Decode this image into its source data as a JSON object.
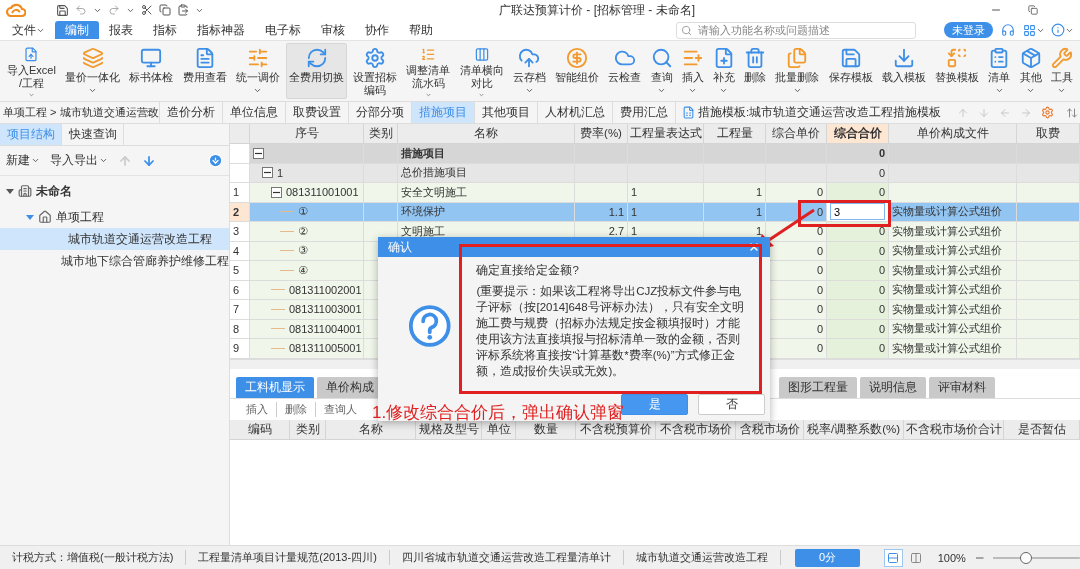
{
  "window": {
    "title": "广联达预算计价 - [招标管理 - 未命名]"
  },
  "menu": [
    {
      "label": "文件",
      "dropdown": true,
      "selected": false
    },
    {
      "label": "编制",
      "dropdown": false,
      "selected": true
    },
    {
      "label": "报表",
      "dropdown": false,
      "selected": false
    },
    {
      "label": "指标",
      "dropdown": false,
      "selected": false
    },
    {
      "label": "指标神器",
      "dropdown": false,
      "selected": false
    },
    {
      "label": "电子标",
      "dropdown": false,
      "selected": false
    },
    {
      "label": "审核",
      "dropdown": false,
      "selected": false
    },
    {
      "label": "协作",
      "dropdown": false,
      "selected": false
    },
    {
      "label": "帮助",
      "dropdown": false,
      "selected": false
    }
  ],
  "search": {
    "placeholder": "请输入功能名称或问题描述"
  },
  "login_button": "未登录",
  "ribbon": [
    {
      "lines": [
        "导入Excel",
        "/工程"
      ],
      "dropdown": true,
      "pressed": false
    },
    {
      "lines": [
        "量价一体化"
      ],
      "dropdown": true,
      "pressed": false
    },
    {
      "lines": [
        "标书体检"
      ],
      "dropdown": false,
      "pressed": false
    },
    {
      "lines": [
        "费用查看"
      ],
      "dropdown": false,
      "pressed": false
    },
    {
      "lines": [
        "统一调价"
      ],
      "dropdown": true,
      "pressed": false
    },
    {
      "lines": [
        "全费用切换"
      ],
      "dropdown": false,
      "pressed": true
    },
    {
      "lines": [
        "设置招标",
        "编码"
      ],
      "dropdown": false,
      "pressed": false
    },
    {
      "lines": [
        "调整清单",
        "流水码"
      ],
      "dropdown": true,
      "pressed": false
    },
    {
      "lines": [
        "清单横向",
        "对比"
      ],
      "dropdown": true,
      "pressed": false
    },
    {
      "lines": [
        "云存档"
      ],
      "dropdown": true,
      "pressed": false
    },
    {
      "lines": [
        "智能组价"
      ],
      "dropdown": false,
      "pressed": false
    },
    {
      "lines": [
        "云检查"
      ],
      "dropdown": false,
      "pressed": false
    },
    {
      "lines": [
        "查询"
      ],
      "dropdown": true,
      "pressed": false
    },
    {
      "lines": [
        "插入"
      ],
      "dropdown": true,
      "pressed": false
    },
    {
      "lines": [
        "补充"
      ],
      "dropdown": true,
      "pressed": false
    },
    {
      "lines": [
        "删除"
      ],
      "dropdown": false,
      "pressed": false
    },
    {
      "lines": [
        "批量删除"
      ],
      "dropdown": true,
      "pressed": false
    },
    {
      "lines": [
        "保存模板"
      ],
      "dropdown": false,
      "pressed": false
    },
    {
      "lines": [
        "载入模板"
      ],
      "dropdown": false,
      "pressed": false
    },
    {
      "lines": [
        "替换模板"
      ],
      "dropdown": false,
      "pressed": false
    },
    {
      "lines": [
        "清单"
      ],
      "dropdown": true,
      "pressed": false
    },
    {
      "lines": [
        "其他"
      ],
      "dropdown": true,
      "pressed": false
    },
    {
      "lines": [
        "工具"
      ],
      "dropdown": true,
      "pressed": false
    }
  ],
  "breadcrumb": "单项工程 > 城市轨道交通运营改",
  "view_tabs": [
    {
      "label": "造价分析",
      "selected": false
    },
    {
      "label": "单位信息",
      "selected": false
    },
    {
      "label": "取费设置",
      "selected": false
    },
    {
      "label": "分部分项",
      "selected": false
    },
    {
      "label": "措施项目",
      "selected": true
    },
    {
      "label": "其他项目",
      "selected": false
    },
    {
      "label": "人材机汇总",
      "selected": false
    },
    {
      "label": "费用汇总",
      "selected": false
    }
  ],
  "template": "措施模板:城市轨道交通运营改造工程措施模板",
  "side_tabs": [
    {
      "label": "项目结构",
      "selected": true
    },
    {
      "label": "快速查询",
      "selected": false
    }
  ],
  "side_toolbar": [
    {
      "label": "新建",
      "dropdown": true
    },
    {
      "label": "导入导出",
      "dropdown": true
    }
  ],
  "move_buttons": [
    {
      "disabled": true
    },
    {
      "disabled": false
    }
  ],
  "tree": [
    {
      "label": "未命名",
      "expanded": true,
      "selected": false,
      "children": [
        {
          "label": "单项工程",
          "expanded": true,
          "selected": false,
          "children": [
            {
              "label": "城市轨道交通运营改造工程",
              "selected": true
            },
            {
              "label": "城市地下综合管廊养护维修工程",
              "selected": false
            }
          ]
        }
      ]
    }
  ],
  "grid": {
    "columns": [
      {
        "label": "序号",
        "current": false
      },
      {
        "label": "类别",
        "current": false
      },
      {
        "label": "名称",
        "current": false
      },
      {
        "label": "费率(%)",
        "current": false
      },
      {
        "label": "工程量表达式",
        "current": false
      },
      {
        "label": "工程量",
        "current": false
      },
      {
        "label": "综合单价",
        "current": false
      },
      {
        "label": "综合合价",
        "current": true
      },
      {
        "label": "单价构成文件",
        "current": false
      },
      {
        "label": "取费",
        "current": false
      }
    ],
    "rows": [
      {
        "kind": "section",
        "expanded": true,
        "name": "措施项目",
        "total": "0",
        "selected": false,
        "editing": false,
        "children": [
          {
            "kind": "subsection",
            "code": "1",
            "expanded": true,
            "name": "总价措施项目",
            "total": "0",
            "selected": false,
            "editing": false,
            "children": [
              {
                "kind": "item",
                "row_no": "1",
                "code": "081311001001",
                "expanded": true,
                "name": "安全文明施工",
                "expr": "1",
                "qty": "1",
                "unit_price": "0",
                "total": "0",
                "selected": false,
                "editing": false,
                "children": [
                  {
                    "kind": "item",
                    "row_no": "2",
                    "code": "①",
                    "name": "环境保护",
                    "rate": "1.1",
                    "expr": "1",
                    "qty": "1",
                    "unit_price": "0",
                    "total": "3",
                    "price_file": "实物量或计算公式组价",
                    "selected": true,
                    "editing": true
                  },
                  {
                    "kind": "item",
                    "row_no": "3",
                    "code": "②",
                    "name": "文明施工",
                    "rate": "2.7",
                    "expr": "1",
                    "qty": "1",
                    "unit_price": "0",
                    "total": "0",
                    "price_file": "实物量或计算公式组价",
                    "selected": false,
                    "editing": false
                  },
                  {
                    "kind": "item",
                    "row_no": "4",
                    "code": "③",
                    "unit_price": "0",
                    "total": "0",
                    "price_file": "实物量或计算公式组价",
                    "selected": false,
                    "editing": false
                  },
                  {
                    "kind": "item",
                    "row_no": "5",
                    "code": "④",
                    "unit_price": "0",
                    "total": "0",
                    "price_file": "实物量或计算公式组价",
                    "selected": false,
                    "editing": false
                  }
                ]
              },
              {
                "kind": "item",
                "row_no": "6",
                "code": "081311002001",
                "unit_price": "0",
                "total": "0",
                "price_file": "实物量或计算公式组价",
                "selected": false,
                "editing": false
              },
              {
                "kind": "item",
                "row_no": "7",
                "code": "081311003001",
                "unit_price": "0",
                "total": "0",
                "price_file": "实物量或计算公式组价",
                "selected": false,
                "editing": false
              },
              {
                "kind": "item",
                "row_no": "8",
                "code": "081311004001",
                "unit_price": "0",
                "total": "0",
                "price_file": "实物量或计算公式组价",
                "selected": false,
                "editing": false
              },
              {
                "kind": "item",
                "row_no": "9",
                "code": "081311005001",
                "unit_price": "0",
                "total": "0",
                "price_file": "实物量或计算公式组价",
                "selected": false,
                "editing": false
              }
            ]
          }
        ]
      }
    ]
  },
  "detail_tabs": [
    {
      "label": "工料机显示",
      "selected": true
    },
    {
      "label": "单价构成",
      "selected": false
    },
    {
      "label": "图形工程量",
      "selected": false
    },
    {
      "label": "说明信息",
      "selected": false
    },
    {
      "label": "评审材料",
      "selected": false
    }
  ],
  "detail_toolbar": [
    "插入",
    "删除",
    "查询人"
  ],
  "detail_columns": [
    "编码",
    "类别",
    "名称",
    "规格及型号",
    "单位",
    "数量",
    "不含税预算价",
    "不含税市场价",
    "含税市场价",
    "税率/调整系数(%)",
    "不含税市场价合计",
    "是否暂估"
  ],
  "dialog": {
    "title": "确认",
    "question": "确定直接给定金额?",
    "message": "(重要提示：如果该工程将导出CJZ投标文件参与电子评标（按[2014]648号评标办法），只有安全文明施工费与规费（招标办法规定按金额填报时）才能使用该方法直接填报与招标清单一致的金额，否则评标系统将直接按“计算基数*费率(%)”方式修正金额，造成报价失误或无效)。",
    "buttons": [
      {
        "label": "是",
        "primary": true
      },
      {
        "label": "否",
        "primary": false
      }
    ]
  },
  "annotation": "1.修改综合合价后，弹出确认弹窗",
  "status_bar": {
    "items": [
      "计税方式：增值税(一般计税方法)",
      "工程量清单项目计量规范(2013-四川)",
      "四川省城市轨道交通运营改造工程量清单计",
      "城市轨道交通运营改造工程"
    ],
    "score": "0分",
    "view_buttons": [
      {
        "selected": true
      },
      {
        "selected": false
      }
    ],
    "zoom": "100%",
    "zoom_slider": {
      "level": 0.38
    }
  }
}
